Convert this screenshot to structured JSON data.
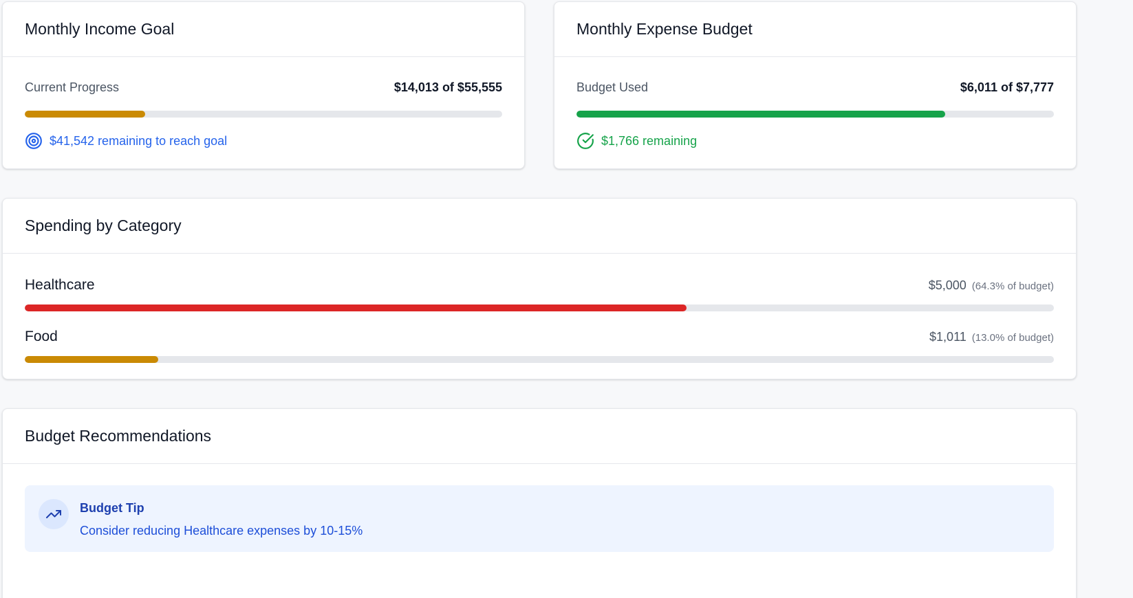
{
  "income_goal": {
    "title": "Monthly Income Goal",
    "label": "Current Progress",
    "amount_text": "$14,013 of $55,555",
    "progress": 0.2522,
    "bar_color": "#ca8a04",
    "status_icon": "target-icon",
    "status_text": "$41,542 remaining to reach goal",
    "status_color": "#2563eb"
  },
  "expense_budget": {
    "title": "Monthly Expense Budget",
    "label": "Budget Used",
    "amount_text": "$6,011 of $7,777",
    "progress": 0.7729,
    "bar_color": "#16a34a",
    "status_icon": "check-circle-icon",
    "status_text": "$1,766 remaining",
    "status_color": "#16a34a"
  },
  "spending": {
    "title": "Spending by Category",
    "categories": [
      {
        "name": "Healthcare",
        "amount": "$5,000",
        "pct_text": "(64.3% of budget)",
        "progress": 0.643,
        "bar_color": "#dc2626"
      },
      {
        "name": "Food",
        "amount": "$1,011",
        "pct_text": "(13.0% of budget)",
        "progress": 0.13,
        "bar_color": "#ca8a04"
      }
    ]
  },
  "recommendations": {
    "title": "Budget Recommendations",
    "tip": {
      "icon": "trending-up-icon",
      "title": "Budget Tip",
      "text": "Consider reducing Healthcare expenses by 10-15%"
    }
  },
  "colors": {
    "track": "#e5e7eb",
    "tip_background": "#eef4ff",
    "tip_accent": "#1e40af"
  }
}
